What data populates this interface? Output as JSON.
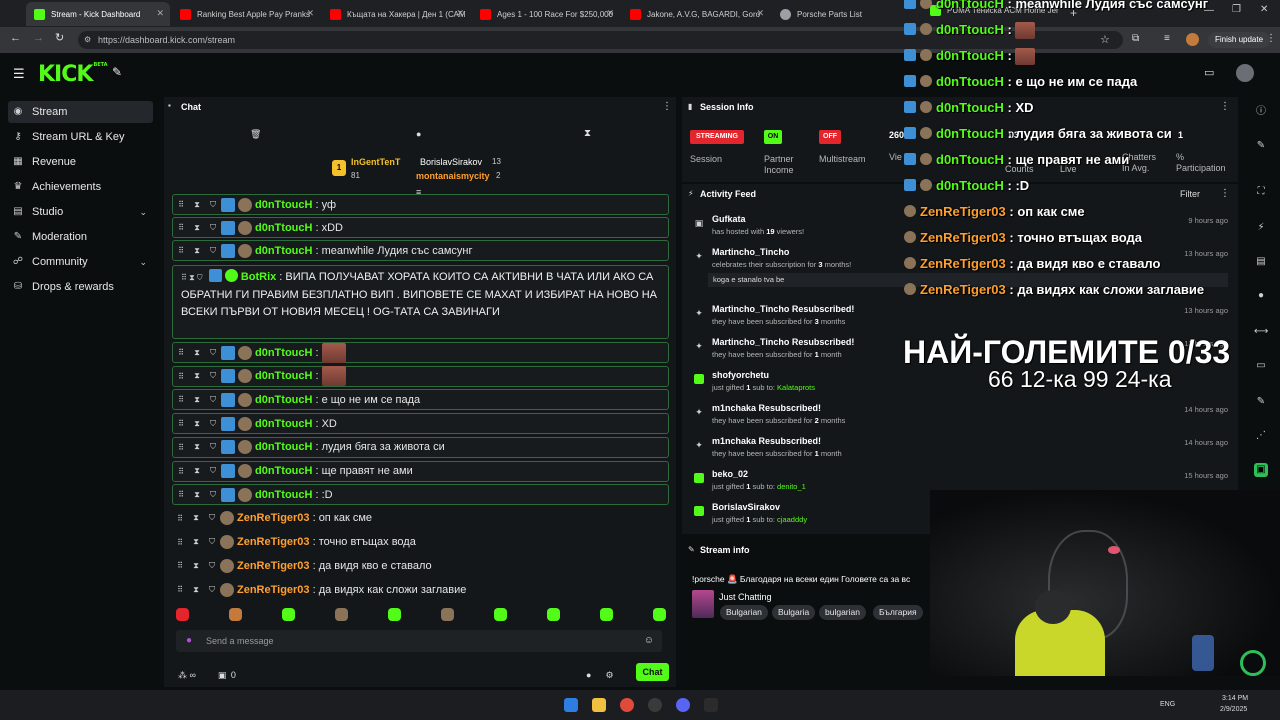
{
  "browser": {
    "tabs": [
      {
        "title": "Stream - Kick Dashboard",
        "color": "#53fc18"
      },
      {
        "title": "Ranking Best Apple Pay Pranks",
        "color": "#ff0000"
      },
      {
        "title": "Къщата на Хакера | Ден 1 (САМ",
        "color": "#ff0000"
      },
      {
        "title": "Ages 1 - 100 Race For $250,000",
        "color": "#ff0000"
      },
      {
        "title": "Jakone, A.V.G, BAGARDI, Goro",
        "color": "#ff0000"
      },
      {
        "title": "Porsche Parts List",
        "color": "#9aa0a6"
      },
      {
        "title": "PUMA Тениска ACM Home Jer",
        "color": "#53fc18"
      }
    ],
    "url": "https://dashboard.kick.com/stream",
    "update_button": "Finish update"
  },
  "brand": {
    "logo": "KICK",
    "beta": "BETA"
  },
  "sidebar": {
    "items": [
      {
        "label": "Stream",
        "icon": "broadcast-icon"
      },
      {
        "label": "Stream URL & Key",
        "icon": "key-icon"
      },
      {
        "label": "Revenue",
        "icon": "chart-icon"
      },
      {
        "label": "Achievements",
        "icon": "trophy-icon"
      },
      {
        "label": "Studio",
        "icon": "studio-icon"
      },
      {
        "label": "Moderation",
        "icon": "wrench-icon"
      },
      {
        "label": "Community",
        "icon": "community-icon"
      },
      {
        "label": "Drops & rewards",
        "icon": "gift-icon"
      }
    ]
  },
  "chat": {
    "title": "Chat",
    "leaderboard": [
      {
        "name": "InGentTenT",
        "count": "81"
      },
      {
        "name": "BorislavSirakov",
        "count": "13"
      },
      {
        "name": "montanaismycity",
        "count": "2"
      }
    ],
    "rows_top": [
      {
        "user": "d0nTtoucH",
        "text": "уф"
      },
      {
        "user": "d0nTtoucH",
        "text": "xDD"
      },
      {
        "user": "d0nTtoucH",
        "text": "meanwhile Лудия със самсунг"
      }
    ],
    "botrix": {
      "user": "BotRix",
      "text": "ВИПА ПОЛУЧАВАТ ХОРАТА КОИТО СА АКТИВНИ В ЧАТА ИЛИ АКО СА ОБРАТНИ ГИ ПРАВИМ БЕЗПЛАТНО ВИП . ВИПОВЕТЕ СЕ МАХАТ И ИЗБИРАТ НА НОВО НА ВСЕКИ ПЪРВИ ОТ НОВИЯ МЕСЕЦ ! OG-ТАТА СА ЗАВИНАГИ"
    },
    "rows_bottom": [
      {
        "user": "d0nTtoucH",
        "text": "",
        "emote": true
      },
      {
        "user": "d0nTtoucH",
        "text": "",
        "emote": true
      },
      {
        "user": "d0nTtoucH",
        "text": "е що не им се пада"
      },
      {
        "user": "d0nTtoucH",
        "text": "XD"
      },
      {
        "user": "d0nTtoucH",
        "text": "лудия бяга за живота си"
      },
      {
        "user": "d0nTtoucH",
        "text": "ще правят не ами"
      },
      {
        "user": "d0nTtoucH",
        "text": ":D"
      }
    ],
    "rows_zen": [
      {
        "user": "ZenReTiger03",
        "text": "оп как сме"
      },
      {
        "user": "ZenReTiger03",
        "text": "точно втъщах вода"
      },
      {
        "user": "ZenReTiger03",
        "text": "да видя кво е ставало"
      },
      {
        "user": "ZenReTiger03",
        "text": "да видях как сложи заглавие"
      }
    ],
    "input_placeholder": "Send a message",
    "send_label": "Chat",
    "footer_count": "0"
  },
  "session": {
    "title": "Session Info",
    "pills": [
      {
        "value": "STREAMING",
        "label": "Session",
        "color": "#e3262e"
      },
      {
        "value": "ON",
        "label": "Partner Income",
        "color": "#53fc18"
      },
      {
        "value": "OFF",
        "label": "Multistream",
        "color": "#e3262e"
      }
    ],
    "viewers_value": "260",
    "viewers_label": "Vie",
    "counts_label": "Counts",
    "live_label": "Live",
    "chatters_label": "Chatters In Avg.",
    "participation_label": "% Participation",
    "extra_value": "03",
    "extra_value2": "1"
  },
  "activity": {
    "title": "Activity Feed",
    "filter": "Filter",
    "items": [
      {
        "name": "Gufkata",
        "sub_pre": "has hosted with ",
        "sub_hl": "19",
        "sub_post": " viewers!",
        "time": "9 hours ago",
        "icon": "host-icon"
      },
      {
        "name": "Martincho_Tincho",
        "sub_pre": "celebrates their subscription for ",
        "sub_hl": "3",
        "sub_post": " months!",
        "time": "13 hours ago",
        "icon": "star-icon",
        "note": "koga e stanalo tva be"
      },
      {
        "name": "Martincho_Tincho Resubscribed!",
        "sub_pre": "they have been subscribed for ",
        "sub_hl": "3",
        "sub_post": " months",
        "time": "13 hours ago",
        "icon": "star-icon"
      },
      {
        "name": "Martincho_Tincho Resubscribed!",
        "sub_pre": "they have been subscribed for ",
        "sub_hl": "1",
        "sub_post": " month",
        "time": "13 hours ago",
        "icon": "star-icon"
      },
      {
        "name": "shofyorchetu",
        "sub_pre": "just gifted ",
        "sub_hl": "1",
        "sub_post": " sub to: ",
        "target": "Kalataprots",
        "time": "",
        "icon": "gift-icon"
      },
      {
        "name": "m1nchaka Resubscribed!",
        "sub_pre": "they have been subscribed for ",
        "sub_hl": "2",
        "sub_post": " months",
        "time": "14 hours ago",
        "icon": "star-icon"
      },
      {
        "name": "m1nchaka Resubscribed!",
        "sub_pre": "they have been subscribed for ",
        "sub_hl": "1",
        "sub_post": " month",
        "time": "14 hours ago",
        "icon": "star-icon"
      },
      {
        "name": "beko_02",
        "sub_pre": "just gifted ",
        "sub_hl": "1",
        "sub_post": " sub to: ",
        "target": "denito_1",
        "time": "15 hours ago",
        "icon": "gift-icon"
      },
      {
        "name": "BorislavSirakov",
        "sub_pre": "just gifted ",
        "sub_hl": "1",
        "sub_post": " sub to: ",
        "target": "cjaadddy",
        "time": "",
        "icon": "gift-icon"
      }
    ]
  },
  "stream_info": {
    "title": "Stream info",
    "stream_title": "!porsche 🚨 Благодаря на всеки един Головете са за вс",
    "category": "Just Chatting",
    "tags": [
      "Bulgarian",
      "Bulgaria",
      "bulgarian",
      "България"
    ]
  },
  "overlay": {
    "chat": [
      {
        "user": "d0nTtoucH",
        "text": "meanwhile Лудия със самсунг"
      },
      {
        "user": "d0nTtoucH",
        "text": "",
        "emote": true
      },
      {
        "user": "d0nTtoucH",
        "text": "",
        "emote": true
      },
      {
        "user": "d0nTtoucH",
        "text": "е що не им се пада"
      },
      {
        "user": "d0nTtoucH",
        "text": "XD"
      },
      {
        "user": "d0nTtoucH",
        "text": "лудия бяга за живота си"
      },
      {
        "user": "d0nTtoucH",
        "text": "ще правят не ами"
      },
      {
        "user": "d0nTtoucH",
        "text": ":D"
      },
      {
        "user": "ZenReTiger03",
        "text": "оп как сме"
      },
      {
        "user": "ZenReTiger03",
        "text": "точно втъщах вода"
      },
      {
        "user": "ZenReTiger03",
        "text": "да видя кво е ставало"
      },
      {
        "user": "ZenReTiger03",
        "text": "да видях как сложи заглавие"
      }
    ],
    "headline": "НАЙ-ГОЛЕМИТЕ 0/33",
    "subline": "66 12-ка 99 24-ка"
  },
  "taskbar": {
    "lang": "ENG",
    "time": "3:14 PM",
    "date": "2/9/2025"
  }
}
